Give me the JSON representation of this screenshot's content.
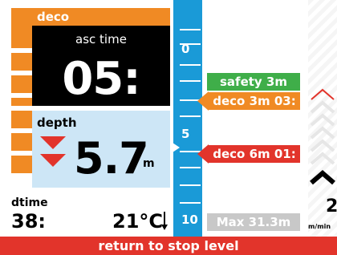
{
  "deco": {
    "header": "deco",
    "asc_label": "asc time",
    "asc_value": "05:"
  },
  "depth": {
    "label": "depth",
    "value": "5.7",
    "unit": "m",
    "direction": "descending"
  },
  "dtime": {
    "label": "dtime",
    "value": "38:"
  },
  "temperature": {
    "value": "21°C"
  },
  "scale": {
    "labels": [
      "0",
      "5",
      "10"
    ]
  },
  "stops": {
    "safety": "safety 3m",
    "deco3": "deco 3m 03:",
    "deco6": "deco 6m 01:",
    "max": "Max 31.3m"
  },
  "ascent_rate": {
    "value": "2",
    "unit": "m/min"
  },
  "footer": "return to stop level",
  "colors": {
    "orange": "#f08a24",
    "blue": "#1a9ad7",
    "red": "#e2342b",
    "green": "#3fae49",
    "black": "#000000",
    "light_blue": "#cde6f6",
    "gray": "#c8c8c8"
  }
}
